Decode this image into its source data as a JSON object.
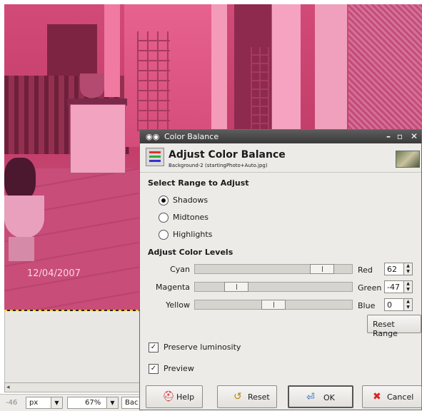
{
  "canvas": {
    "date_stamp": "12/04/2007"
  },
  "statusbar": {
    "coordinate": "-46",
    "unit": "px",
    "zoom": "67%",
    "layer_text": "Bac"
  },
  "dialog": {
    "window_title": "Color Balance",
    "header_title": "Adjust Color Balance",
    "header_subtitle": "Background-2 (startingPhoto+Auto.jpg)",
    "range_section": "Select Range to Adjust",
    "ranges": [
      {
        "label": "Shadows",
        "selected": true
      },
      {
        "label": "Midtones",
        "selected": false
      },
      {
        "label": "Highlights",
        "selected": false
      }
    ],
    "levels_section": "Adjust Color Levels",
    "sliders": [
      {
        "left": "Cyan",
        "right": "Red",
        "value": "62"
      },
      {
        "left": "Magenta",
        "right": "Green",
        "value": "-47"
      },
      {
        "left": "Yellow",
        "right": "Blue",
        "value": "0"
      }
    ],
    "slider_min": -100,
    "slider_max": 100,
    "reset_range": "Reset Range",
    "preserve_luminosity": {
      "label": "Preserve luminosity",
      "checked": true
    },
    "preview": {
      "label": "Preview",
      "checked": true
    },
    "buttons": {
      "help": "Help",
      "reset": "Reset",
      "ok": "OK",
      "cancel": "Cancel"
    }
  },
  "colors": {
    "titlebar": "#3a3a3a",
    "dialog_bg": "#ecebe8",
    "canvas_tint": "#c23d69"
  }
}
